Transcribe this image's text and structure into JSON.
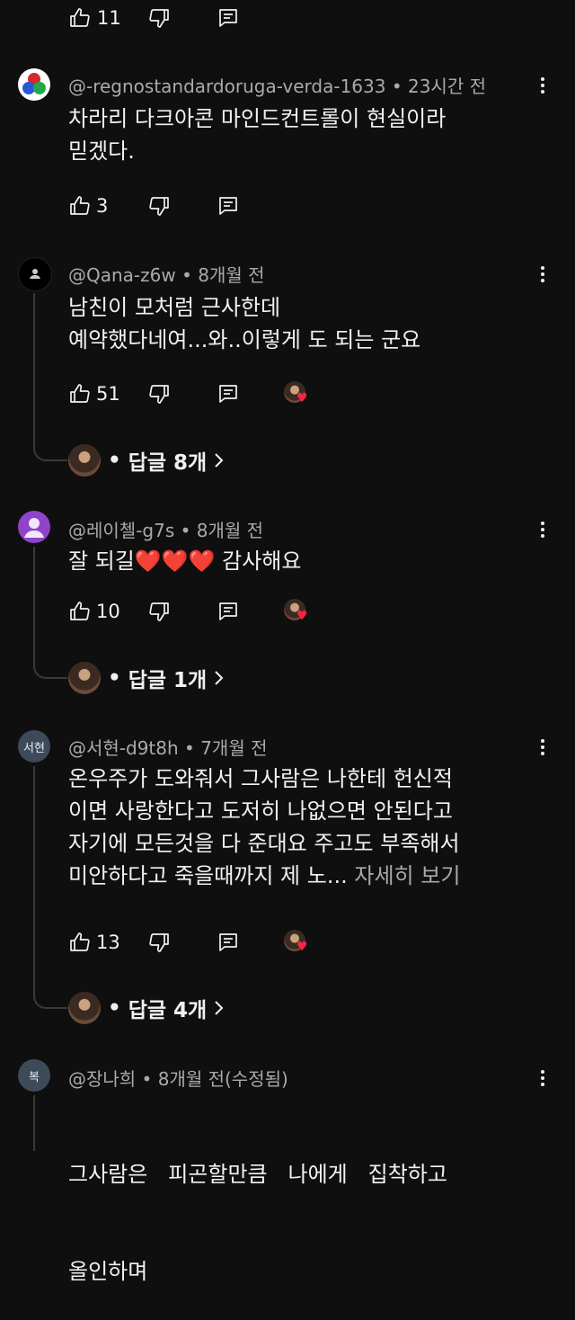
{
  "top_actions": {
    "like_count": "11"
  },
  "comments": [
    {
      "author": "@-regnostandardoruga-verda-1633",
      "time": "23시간 전",
      "lines": [
        "차라리 다크아콘 마인드컨트롤이 현실이라",
        "믿겠다."
      ],
      "likes": "3"
    },
    {
      "author": "@Qana-z6w",
      "time": "8개월 전",
      "lines": [
        "남친이 모처럼 근사한데",
        "예약했다네여...와..이렇게 도 되는 군요"
      ],
      "likes": "51",
      "replies": "답글 8개"
    },
    {
      "author": "@레이첼-g7s",
      "time": "8개월 전",
      "lines": [
        "잘 되길❤️❤️❤️ 감사해요"
      ],
      "likes": "10",
      "replies": "답글 1개"
    },
    {
      "avatar_text": "서현",
      "author": "@서현-d9t8h",
      "time": "7개월 전",
      "lines": [
        "온우주가 도와줘서 그사람은 나한테 헌신적",
        "이면 사랑한다고 도저히 나없으면 안된다고",
        "자기에 모든것을 다 준대요 주고도 부족해서",
        "미안하다고 죽을때까지 제 노..."
      ],
      "more": "자세히 보기",
      "likes": "13",
      "replies": "답글 4개"
    },
    {
      "avatar_text": "복",
      "author": "@장나희",
      "time": "8개월 전(수정됨)",
      "lines": [
        "그사람은   피곤할만큼   나에게   집착하고",
        "올인하며"
      ]
    }
  ],
  "colors": {
    "accent_heart": "#ff2244",
    "background": "#0f0f0f",
    "secondary_text": "#aaaaaa"
  },
  "icons": [
    "thumb-up-icon",
    "thumb-down-icon",
    "comment-reply-icon",
    "more-vert-icon",
    "chevron-right-icon",
    "heart-icon"
  ]
}
